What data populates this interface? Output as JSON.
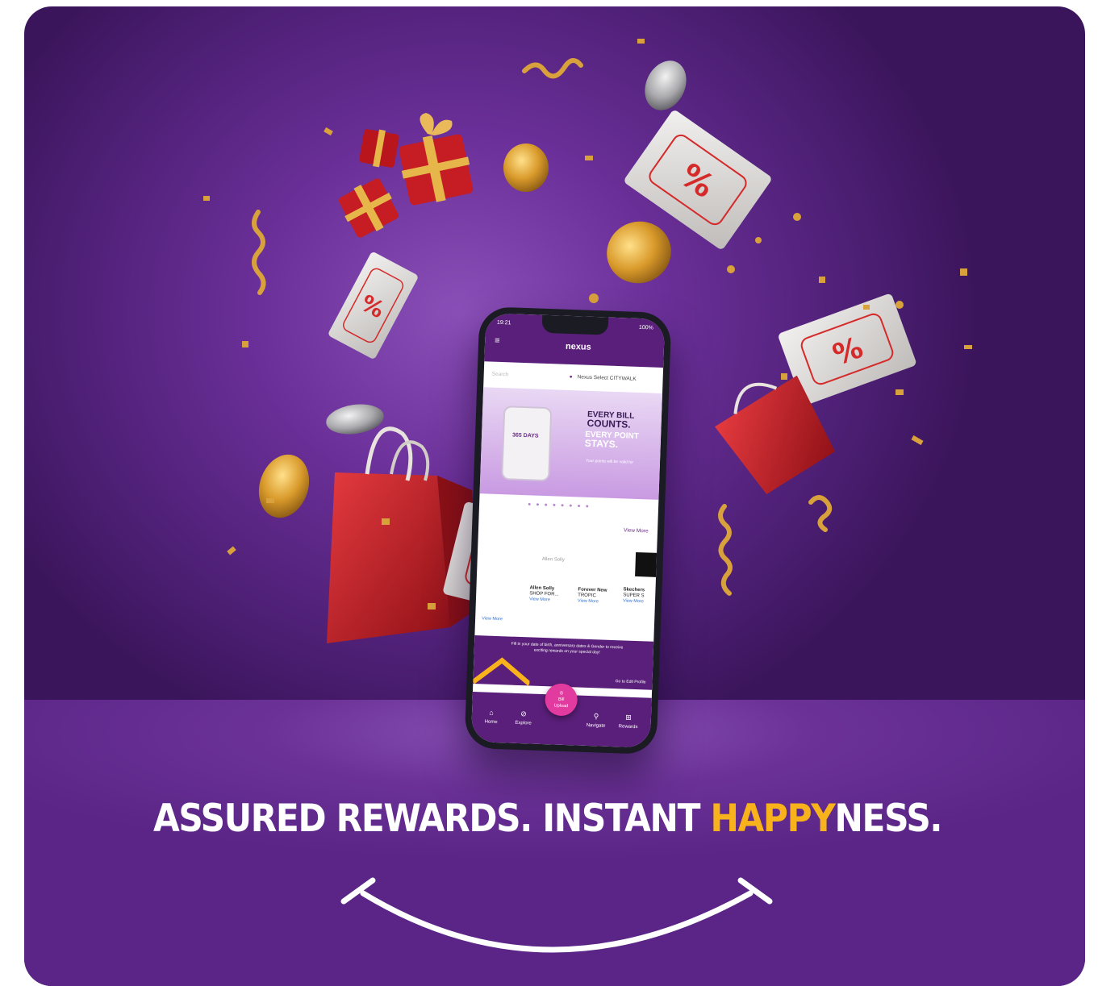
{
  "headline": {
    "part1": "ASSURED REWARDS. INSTANT ",
    "highlight": "HAPPY",
    "part2": "NESS."
  },
  "phone": {
    "status_time": "19:21",
    "status_battery": "100%",
    "app_logo": "nexus",
    "location_placeholder": "Search",
    "location_value": "Nexus Select CITYWALK",
    "banner": {
      "line1": "EVERY BILL",
      "line2": "COUNTS.",
      "line3": "EVERY POINT",
      "line4": "STAYS.",
      "sub": "Your points will be valid for",
      "receipt_days": "365 DAYS"
    },
    "view_more": "View More",
    "brands": [
      {
        "name": "Allen Solly",
        "sub": "SHOP FOR...",
        "link": "View More"
      },
      {
        "name": "Forever New",
        "sub": "TROPIC",
        "link": "View More"
      },
      {
        "name": "Skechers",
        "sub": "SUPER S",
        "link": "View More"
      }
    ],
    "brand_left_link": "View More",
    "brand_row_label": "Allen Solly",
    "promo_text": "Fill in your date of birth, anniversary dates & Gender to receive exciting rewards on your special day!",
    "promo_cta": "Go to Edit Profile",
    "nav": {
      "home": "Home",
      "explore": "Explore",
      "upload_line1": "Bill",
      "upload_line2": "Upload",
      "navigate": "Navigate",
      "rewards": "Rewards"
    }
  },
  "coupon_symbol": "%",
  "colors": {
    "background": "#5a2586",
    "highlight": "#f7b21c",
    "bag_red": "#c8232b",
    "coin_gold": "#c9902a"
  }
}
